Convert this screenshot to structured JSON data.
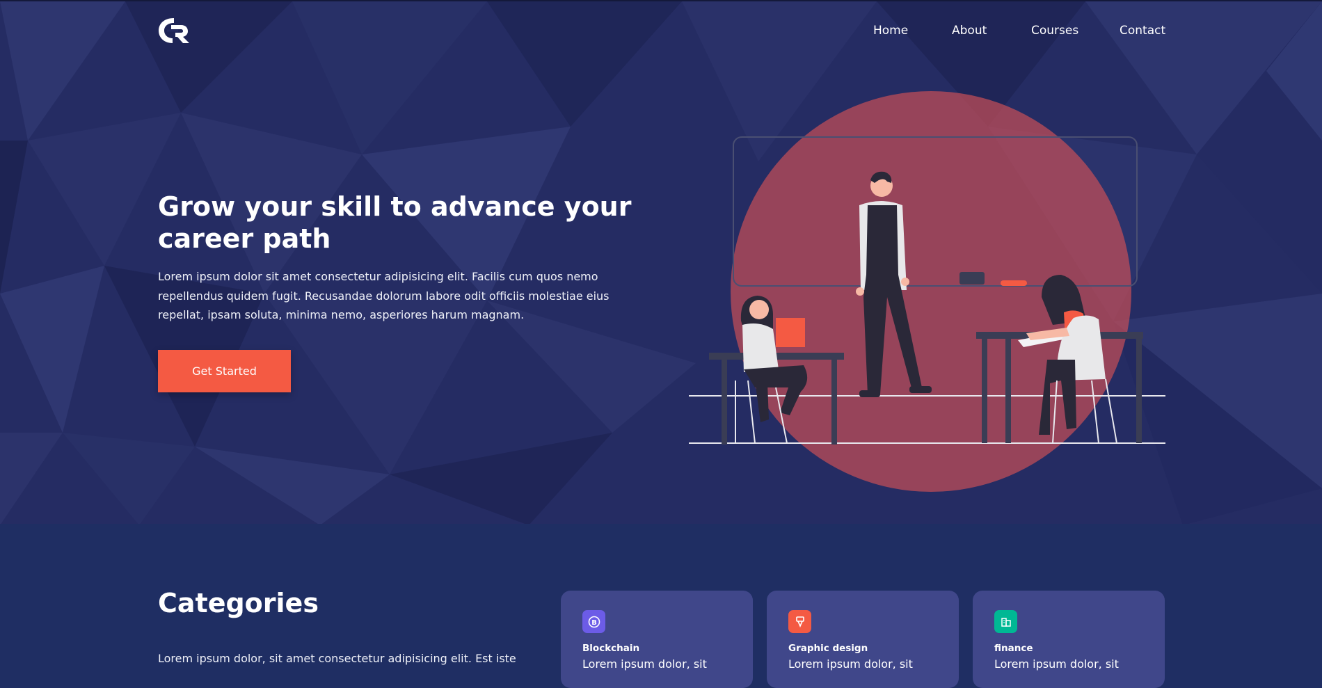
{
  "nav": {
    "items": [
      "Home",
      "About",
      "Courses",
      "Contact"
    ]
  },
  "hero": {
    "title": "Grow your skill to advance your career path",
    "description": "Lorem ipsum dolor sit amet consectetur adipisicing elit. Facilis cum quos nemo repellendus quidem fugit. Recusandae dolorum labore odit officiis molestiae eius repellat, ipsam soluta, minima nemo, asperiores harum magnam.",
    "cta_label": "Get Started"
  },
  "categories": {
    "title": "Categories",
    "description": "Lorem ipsum dolor, sit amet consectetur adipisicing elit. Est iste",
    "cards": [
      {
        "name": "Blockchain",
        "text": "Lorem ipsum dolor, sit",
        "icon": "bitcoin-icon",
        "color": "#6c5ce7"
      },
      {
        "name": "Graphic design",
        "text": "Lorem ipsum dolor, sit",
        "icon": "pen-tool-icon",
        "color": "#f45a43"
      },
      {
        "name": "finance",
        "text": "Lorem ipsum dolor, sit",
        "icon": "building-icon",
        "color": "#00b894"
      }
    ]
  },
  "colors": {
    "accent": "#f45a43",
    "hero_bg": "#242b62",
    "section_bg": "#1f2e63",
    "card_bg": "#40478a"
  }
}
